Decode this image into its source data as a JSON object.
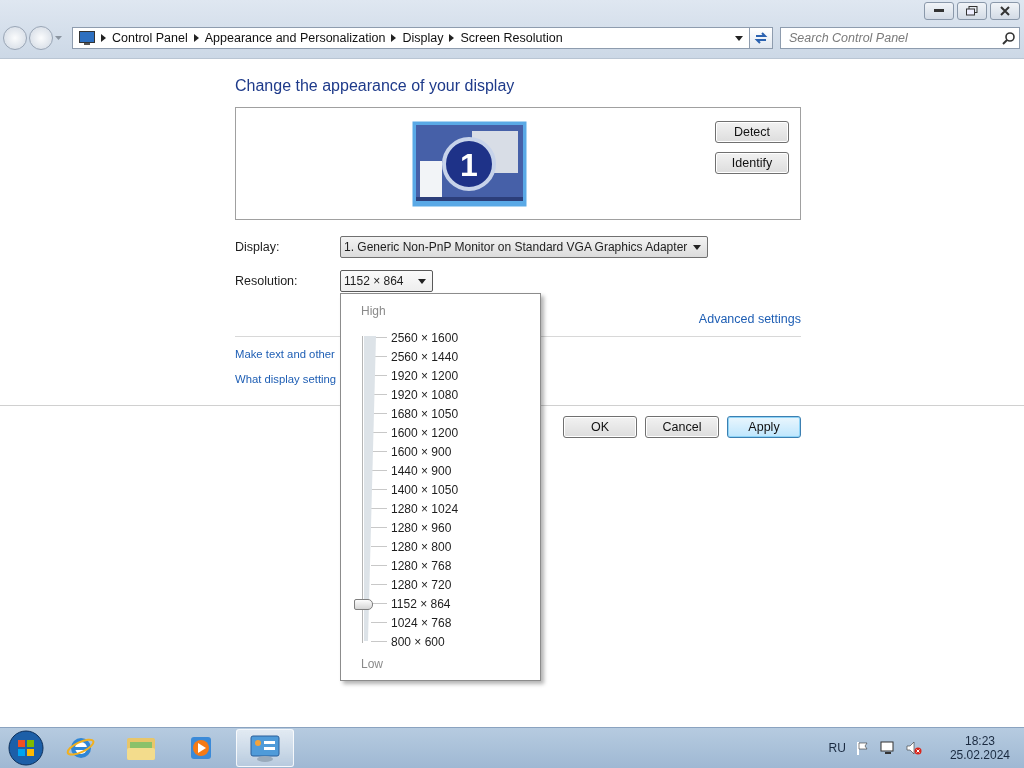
{
  "address_bar": {
    "breadcrumbs": [
      "Control Panel",
      "Appearance and Personalization",
      "Display",
      "Screen Resolution"
    ],
    "search_placeholder": "Search Control Panel"
  },
  "heading": "Change the appearance of your display",
  "monitor_preview": {
    "number": "1"
  },
  "preview_buttons": [
    "Detect",
    "Identify"
  ],
  "display": {
    "label": "Display:",
    "value": "1. Generic Non-PnP Monitor on Standard VGA Graphics Adapter"
  },
  "resolution": {
    "label": "Resolution:",
    "value": "1152 × 864",
    "expanded": true,
    "high_label": "High",
    "low_label": "Low",
    "options": [
      {
        "label": "2560 × 1600",
        "selected": false
      },
      {
        "label": "2560 × 1440",
        "selected": false
      },
      {
        "label": "1920 × 1200",
        "selected": false
      },
      {
        "label": "1920 × 1080",
        "selected": false
      },
      {
        "label": "1680 × 1050",
        "selected": false
      },
      {
        "label": "1600 × 1200",
        "selected": false
      },
      {
        "label": "1600 × 900",
        "selected": false
      },
      {
        "label": "1440 × 900",
        "selected": false
      },
      {
        "label": "1400 × 1050",
        "selected": false
      },
      {
        "label": "1280 × 1024",
        "selected": false
      },
      {
        "label": "1280 × 960",
        "selected": false
      },
      {
        "label": "1280 × 800",
        "selected": false
      },
      {
        "label": "1280 × 768",
        "selected": false
      },
      {
        "label": "1280 × 720",
        "selected": false
      },
      {
        "label": "1152 × 864",
        "selected": true
      },
      {
        "label": "1024 × 768",
        "selected": false
      },
      {
        "label": "800 × 600",
        "selected": false
      }
    ]
  },
  "advanced_link": "Advanced settings",
  "links": [
    "Make text and other",
    "What display setting"
  ],
  "dialog_buttons": [
    {
      "label": "OK",
      "focused": false
    },
    {
      "label": "Cancel",
      "focused": false
    },
    {
      "label": "Apply",
      "focused": true
    }
  ],
  "taskbar": {
    "apps": [
      {
        "kind": "browser",
        "active": false
      },
      {
        "kind": "folder",
        "active": false
      },
      {
        "kind": "media",
        "active": false
      },
      {
        "kind": "control",
        "active": true
      }
    ],
    "language": "RU",
    "time": "18:23",
    "date": "25.02.2024"
  }
}
